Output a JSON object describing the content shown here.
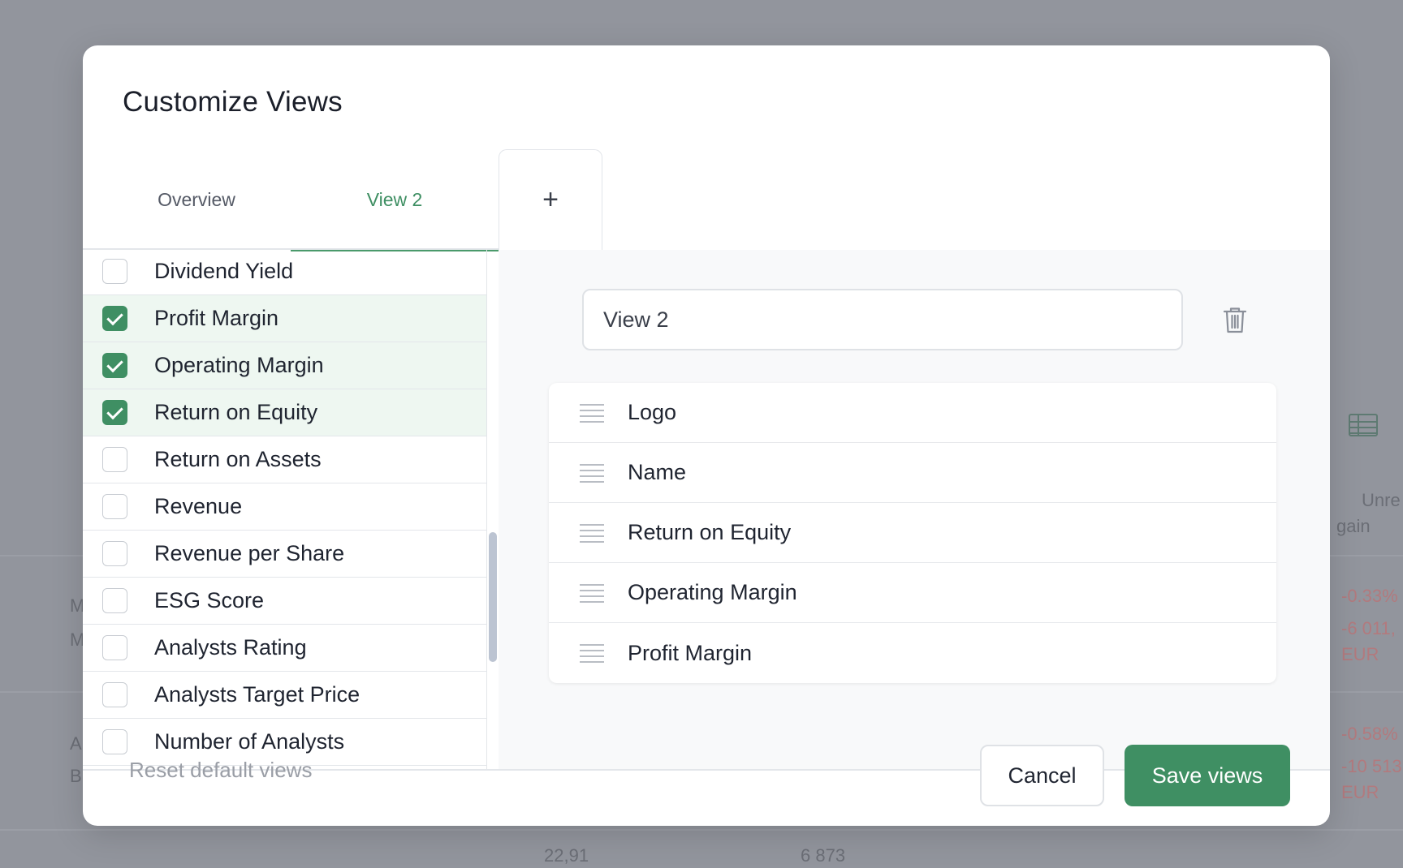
{
  "background": {
    "texts": [
      "22,91",
      "6 873",
      "-0.33%",
      "-6 011,",
      "EUR",
      "-0.58%",
      "-10 513",
      "EUR",
      "Unre",
      "gain",
      "M",
      "M",
      "A",
      "B"
    ]
  },
  "modal": {
    "title": "Customize Views",
    "tabs": [
      {
        "label": "Overview",
        "active": false
      },
      {
        "label": "View 2",
        "active": true
      }
    ],
    "add_tab_label": "+",
    "metrics": [
      {
        "label": "Dividend Yield",
        "checked": false
      },
      {
        "label": "Profit Margin",
        "checked": true
      },
      {
        "label": "Operating Margin",
        "checked": true
      },
      {
        "label": "Return on Equity",
        "checked": true
      },
      {
        "label": "Return on Assets",
        "checked": false
      },
      {
        "label": "Revenue",
        "checked": false
      },
      {
        "label": "Revenue per Share",
        "checked": false
      },
      {
        "label": "ESG Score",
        "checked": false
      },
      {
        "label": "Analysts Rating",
        "checked": false
      },
      {
        "label": "Analysts Target Price",
        "checked": false
      },
      {
        "label": "Number of Analysts",
        "checked": false
      }
    ],
    "view_name": {
      "value": "View 2"
    },
    "columns": [
      "Logo",
      "Name",
      "Return on Equity",
      "Operating Margin",
      "Profit Margin"
    ],
    "footer": {
      "reset_label": "Reset default views",
      "cancel_label": "Cancel",
      "save_label": "Save views"
    }
  },
  "colors": {
    "accent": "#3f8f63",
    "checked_row_bg": "#eef7f1",
    "overlay": "#92959d"
  }
}
